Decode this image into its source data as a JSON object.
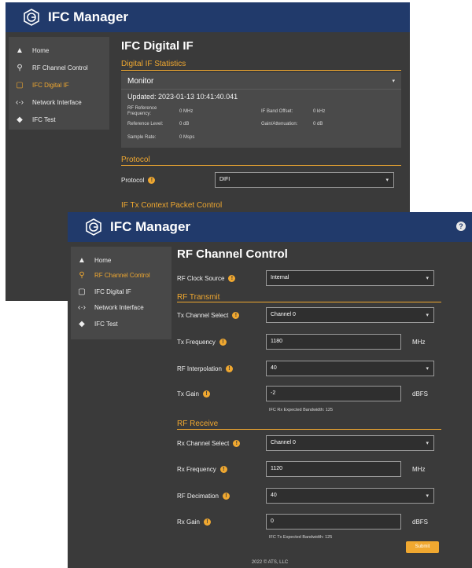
{
  "app": {
    "name": "IFC Manager",
    "help_icon": "help-circle-icon"
  },
  "nav": [
    {
      "label": "Home",
      "icon": "home-icon"
    },
    {
      "label": "RF Channel Control",
      "icon": "antenna-icon"
    },
    {
      "label": "IFC Digital IF",
      "icon": "digital-if-icon"
    },
    {
      "label": "Network Interface",
      "icon": "network-arrows-icon"
    },
    {
      "label": "IFC Test",
      "icon": "test-icon"
    }
  ],
  "back_window": {
    "title": "IFC Digital IF",
    "stats_section": "Digital IF Statistics",
    "monitor": {
      "header": "Monitor",
      "updated": "Updated: 2023-01-13 10:41:40.041",
      "rf_ref_label_1": "RF Reference",
      "rf_ref_label_2": "Frequency:",
      "rf_ref_value": "0 MHz",
      "if_band_label": "IF Band Offset:",
      "if_band_value": "0 kHz",
      "ref_level_label": "Reference Level:",
      "ref_level_value": "0 dB",
      "gain_label": "Gain/Attenuation:",
      "gain_value": "0 dB",
      "sample_label": "Sample Rate:",
      "sample_value": "0 Msps"
    },
    "protocol_section": "Protocol",
    "protocol_label": "Protocol",
    "protocol_value": "DIFI",
    "txctx_section": "IF Tx Context Packet Control"
  },
  "front_window": {
    "title": "RF Channel Control",
    "rf_clock": {
      "label": "RF Clock Source",
      "value": "Internal"
    },
    "tx_section": "RF Transmit",
    "tx_channel": {
      "label": "Tx Channel Select",
      "value": "Channel 0"
    },
    "tx_freq": {
      "label": "Tx Frequency",
      "value": "1180",
      "unit": "MHz"
    },
    "rf_interp": {
      "label": "RF Interpolation",
      "value": "40"
    },
    "tx_gain": {
      "label": "Tx Gain",
      "value": "-2",
      "unit": "dBFS"
    },
    "tx_hint": "IFC Rx Expected Bandwidth: 125",
    "rx_section": "RF Receive",
    "rx_channel": {
      "label": "Rx Channel Select",
      "value": "Channel 0"
    },
    "rx_freq": {
      "label": "Rx Frequency",
      "value": "1120",
      "unit": "MHz"
    },
    "rf_decim": {
      "label": "RF Decimation",
      "value": "40"
    },
    "rx_gain": {
      "label": "Rx Gain",
      "value": "0",
      "unit": "dBFS"
    },
    "rx_hint": "IFC Tx Expected Bandwidth: 125",
    "submit_label": "Submit",
    "footer": "2022 © ATS, LLC"
  },
  "colors": {
    "header": "#213a6b",
    "accent": "#f0a830",
    "panel": "#3a3a3a"
  }
}
